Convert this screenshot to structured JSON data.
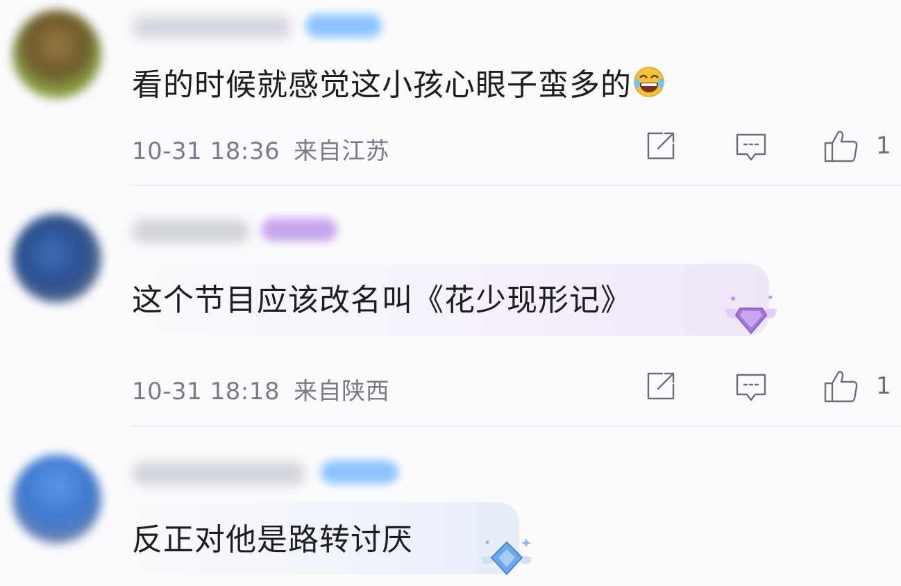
{
  "comments": [
    {
      "text": "看的时候就感觉这小孩心眼子蛮多的",
      "emoji": "laughing-tears-emoji",
      "time": "10-31 18:36",
      "location": "来自江苏",
      "likes": "1"
    },
    {
      "text": "这个节目应该改名叫《花少现形记》",
      "time": "10-31 18:18",
      "location": "来自陕西",
      "likes": "1"
    },
    {
      "text": "反正对他是路转讨厌"
    }
  ],
  "icons": {
    "share": "share-icon",
    "reply": "comment-icon",
    "like": "thumbs-up-icon",
    "decoration_purple": "purple-gem-wings-icon",
    "decoration_blue": "blue-gem-icon"
  },
  "colors": {
    "background": "#fbfbfd",
    "text": "#1d1d1f",
    "meta": "#7b7888",
    "badge_blue": "#8ec4ff",
    "badge_purple": "#c9a8ee"
  }
}
